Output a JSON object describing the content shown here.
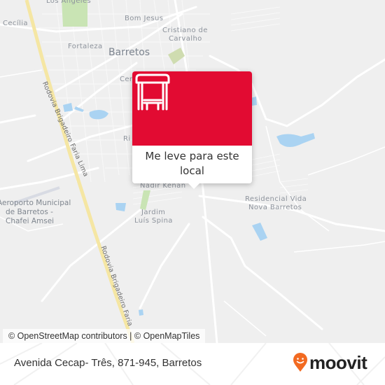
{
  "map": {
    "labels": {
      "los_angeles": "Los Angeles",
      "cecilia": "Cecília",
      "bom_jesus": "Bom Jesus",
      "cristiano": "Cristiano de",
      "carvalho": "Carvalho",
      "fortaleza": "Fortaleza",
      "barretos": "Barretos",
      "centro_partial": "Cen",
      "rio_partial": "Ri",
      "nadir_kenan": "Nadir Kenan",
      "jardim": "Jardim",
      "luis_spina": "Luís Spina",
      "residencial_vida": "Residencial Vida",
      "nova_barretos": "Nova Barretos",
      "airport_line1": "Aeroporto Municipal",
      "airport_line2": "de Barretos -",
      "airport_line3": "Chafei Amsei",
      "highway_upper": "Rodovia Brigadeiro Faria Lima",
      "highway_lower": "Rodovia Brigadeiro Faria"
    },
    "colors": {
      "background": "#efefef",
      "highway": "#f5e6a3",
      "water": "#aad3f2",
      "park": "#c9e4b4"
    }
  },
  "popup": {
    "icon": "bus-stop-icon",
    "label": "Me leve para este local",
    "accent_color": "#e20b32"
  },
  "attribution": "© OpenStreetMap contributors | © OpenMapTiles",
  "footer": {
    "address": "Avenida Cecap- Três, 871-945, Barretos",
    "brand": "moovit",
    "brand_icon": "moovit-pin-icon",
    "brand_color": "#f26a21"
  }
}
